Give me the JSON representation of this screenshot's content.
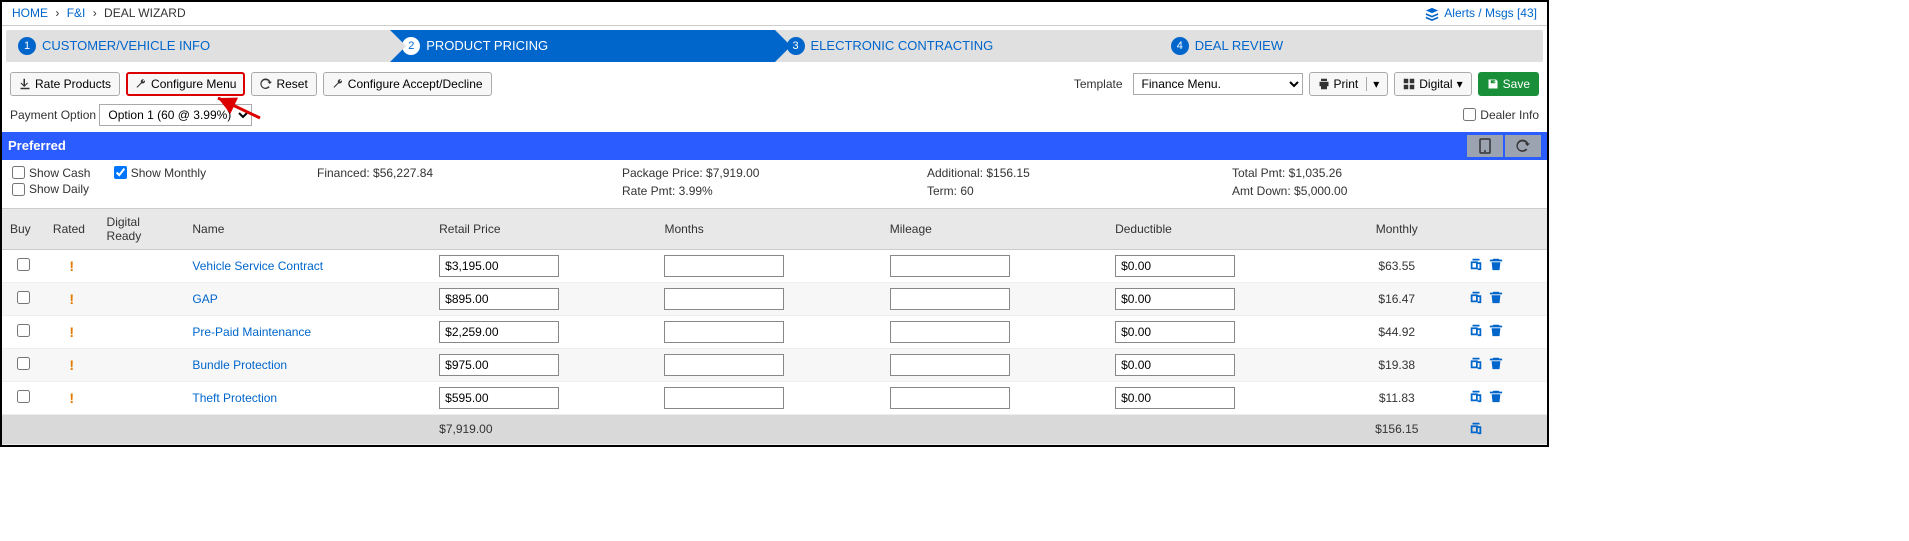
{
  "breadcrumb": {
    "home": "HOME",
    "fi": "F&I",
    "current": "DEAL WIZARD"
  },
  "alerts": {
    "label": "Alerts / Msgs [43]"
  },
  "steps": [
    {
      "num": "1",
      "label": "CUSTOMER/VEHICLE INFO"
    },
    {
      "num": "2",
      "label": "PRODUCT PRICING"
    },
    {
      "num": "3",
      "label": "ELECTRONIC CONTRACTING"
    },
    {
      "num": "4",
      "label": "DEAL REVIEW"
    }
  ],
  "toolbar": {
    "rate_products": "Rate Products",
    "configure_menu": "Configure Menu",
    "reset": "Reset",
    "configure_accept": "Configure Accept/Decline",
    "template_label": "Template",
    "template_value": "Finance Menu.",
    "print": "Print",
    "digital": "Digital",
    "save": "Save"
  },
  "payment": {
    "label": "Payment Option",
    "value": "Option 1 (60 @ 3.99%)",
    "dealer_info": "Dealer Info"
  },
  "preferred": {
    "label": "Preferred"
  },
  "summary": {
    "show_cash": "Show Cash",
    "show_monthly": "Show Monthly",
    "show_daily": "Show Daily",
    "financed": "Financed: $56,227.84",
    "package": "Package Price: $7,919.00",
    "rate": "Rate Pmt: 3.99%",
    "additional": "Additional: $156.15",
    "term": "Term: 60",
    "total": "Total Pmt: $1,035.26",
    "amt_down": "Amt Down: $5,000.00"
  },
  "headers": {
    "buy": "Buy",
    "rated": "Rated",
    "digital_ready": "Digital Ready",
    "name": "Name",
    "retail": "Retail Price",
    "months": "Months",
    "mileage": "Mileage",
    "deductible": "Deductible",
    "monthly": "Monthly"
  },
  "rows": [
    {
      "name": "Vehicle Service Contract",
      "retail": "$3,195.00",
      "months": "",
      "mileage": "",
      "deductible": "$0.00",
      "monthly": "$63.55"
    },
    {
      "name": "GAP",
      "retail": "$895.00",
      "months": "",
      "mileage": "",
      "deductible": "$0.00",
      "monthly": "$16.47"
    },
    {
      "name": "Pre-Paid Maintenance",
      "retail": "$2,259.00",
      "months": "",
      "mileage": "",
      "deductible": "$0.00",
      "monthly": "$44.92"
    },
    {
      "name": "Bundle Protection",
      "retail": "$975.00",
      "months": "",
      "mileage": "",
      "deductible": "$0.00",
      "monthly": "$19.38"
    },
    {
      "name": "Theft Protection",
      "retail": "$595.00",
      "months": "",
      "mileage": "",
      "deductible": "$0.00",
      "monthly": "$11.83"
    }
  ],
  "totals": {
    "retail": "$7,919.00",
    "monthly": "$156.15"
  }
}
